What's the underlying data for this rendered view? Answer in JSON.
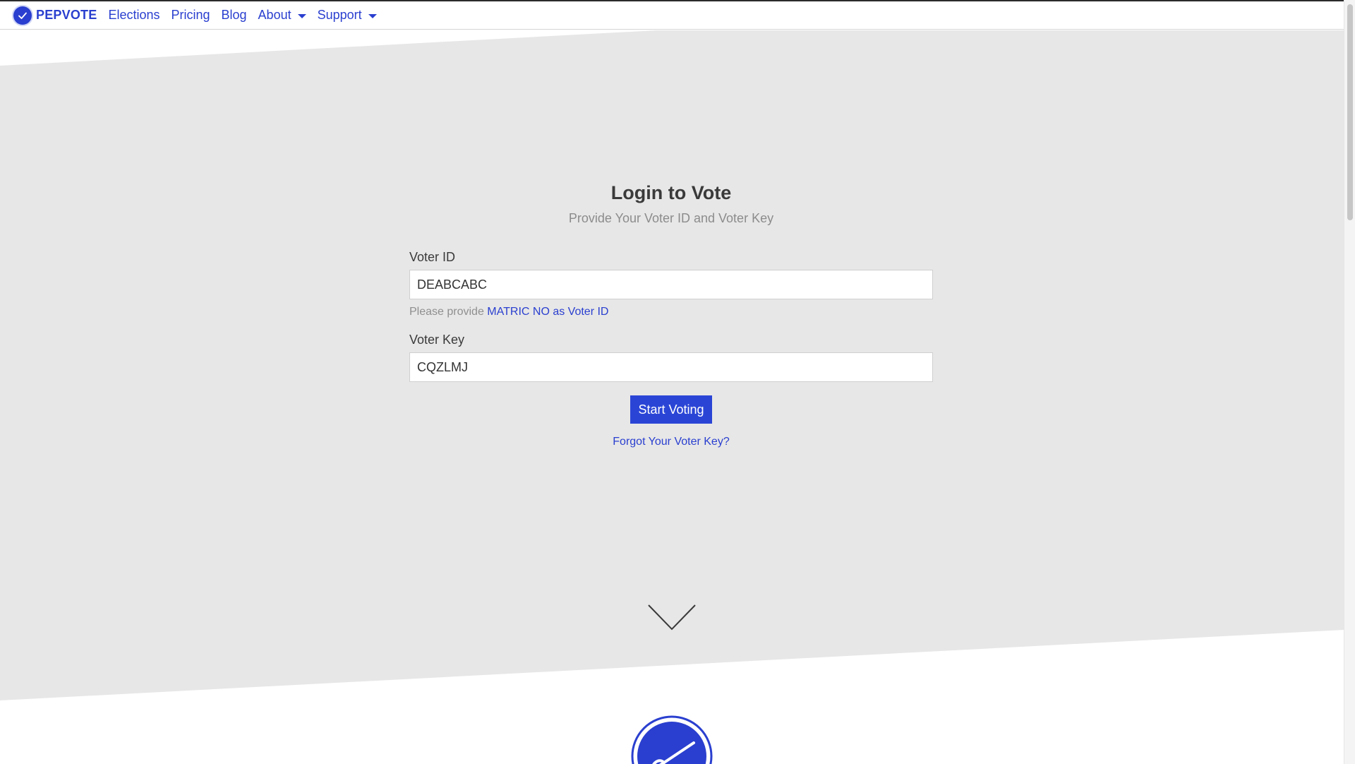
{
  "navbar": {
    "brand_name": "PEPVOTE",
    "links": [
      {
        "label": "Elections"
      },
      {
        "label": "Pricing"
      },
      {
        "label": "Blog"
      },
      {
        "label": "About",
        "dropdown": true
      },
      {
        "label": "Support",
        "dropdown": true
      }
    ]
  },
  "login": {
    "title": "Login to Vote",
    "subtitle": "Provide Your Voter ID and Voter Key",
    "voter_id_label": "Voter ID",
    "voter_id_value": "DEABCABC",
    "help_prefix": "Please provide",
    "help_link": "MATRIC NO as Voter ID",
    "voter_key_label": "Voter Key",
    "voter_key_value": "CQZLMJ",
    "submit_label": "Start Voting",
    "forgot_label": "Forgot Your Voter Key?"
  },
  "colors": {
    "accent": "#2a3fcf",
    "button": "#2a45d6",
    "hero_background": "#e7e7e7"
  },
  "icons": [
    "checkmark-logo-icon",
    "caret-down-icon",
    "chevron-down-icon"
  ]
}
